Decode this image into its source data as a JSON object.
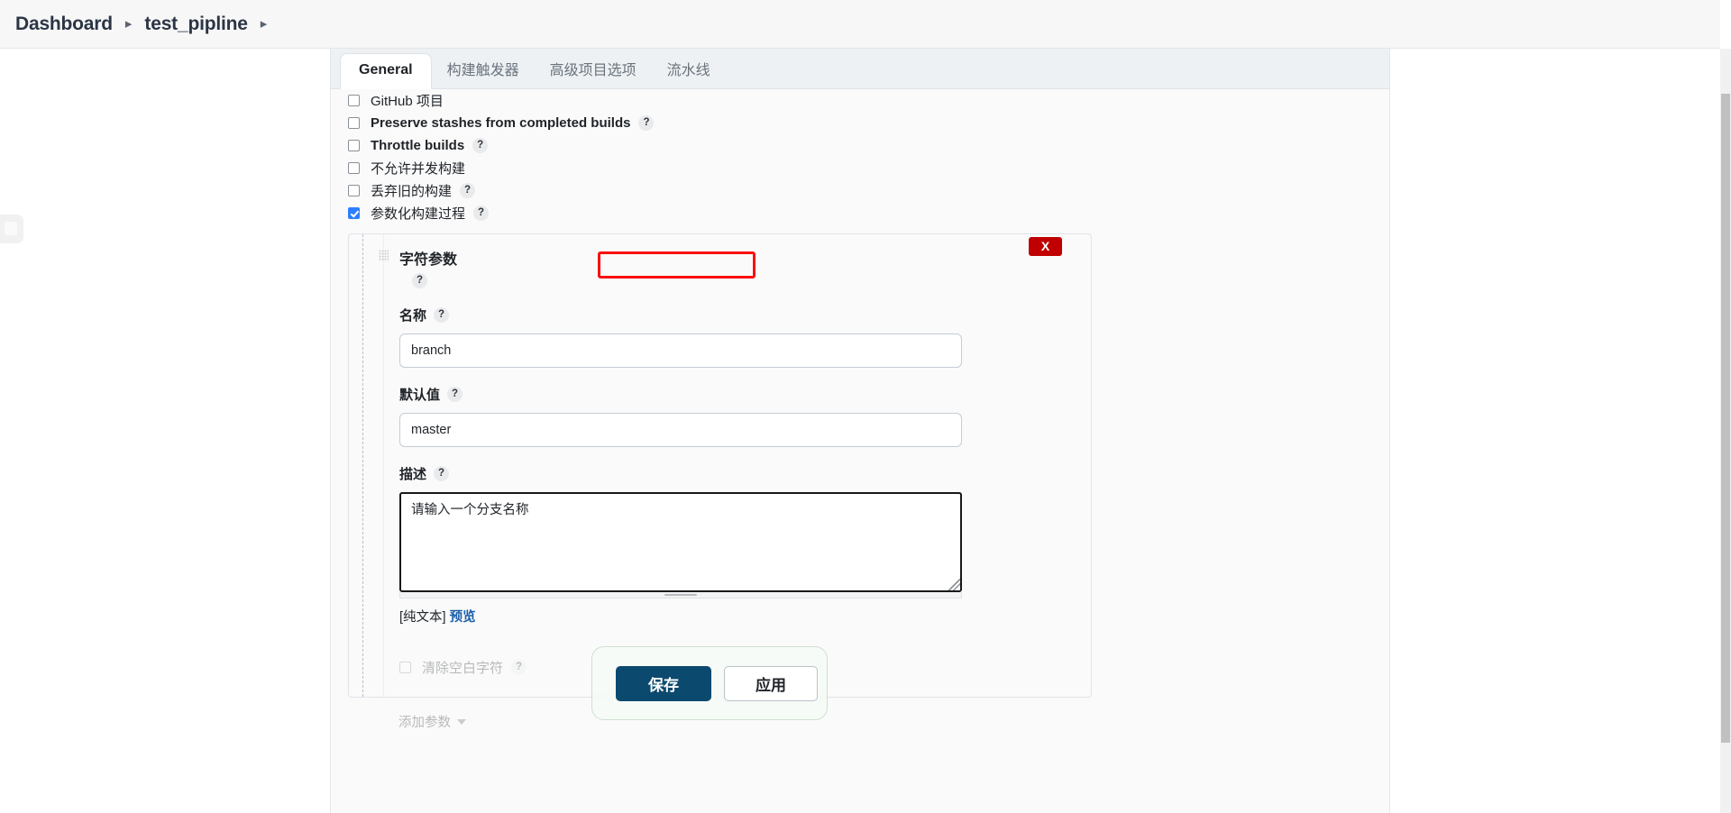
{
  "breadcrumb": {
    "items": [
      {
        "label": "Dashboard"
      },
      {
        "label": "test_pipline"
      }
    ],
    "separator": "▸"
  },
  "tabs": [
    {
      "label": "General",
      "active": true
    },
    {
      "label": "构建触发器",
      "active": false
    },
    {
      "label": "高级项目选项",
      "active": false
    },
    {
      "label": "流水线",
      "active": false
    }
  ],
  "checkboxes": [
    {
      "label": "GitHub 项目",
      "checked": false,
      "help": false,
      "cn": true
    },
    {
      "label": "Preserve stashes from completed builds",
      "checked": false,
      "help": true,
      "cn": false
    },
    {
      "label": "Throttle builds",
      "checked": false,
      "help": true,
      "cn": false
    },
    {
      "label": "不允许并发构建",
      "checked": false,
      "help": false,
      "cn": true
    },
    {
      "label": "丢弃旧的构建",
      "checked": false,
      "help": true,
      "cn": true
    },
    {
      "label": "参数化构建过程",
      "checked": true,
      "help": true,
      "cn": true,
      "highlighted": true
    }
  ],
  "parameter": {
    "title": "字符参数",
    "delete_label": "X",
    "help_glyph": "?",
    "name": {
      "label": "名称",
      "value": "branch"
    },
    "default_value": {
      "label": "默认值",
      "value": "master"
    },
    "description": {
      "label": "描述",
      "value": "请输入一个分支名称",
      "markup_note": "[纯文本]",
      "preview_link": "预览"
    },
    "trim_whitespace": {
      "label": "清除空白字符",
      "checked": false
    },
    "add_parameter": "添加参数"
  },
  "savebar": {
    "save_label": "保存",
    "apply_label": "应用"
  },
  "colors": {
    "accent_blue": "#2b7fff",
    "save_button": "#0b4a6e",
    "delete_red": "#c00000",
    "highlight_red": "#fb1010",
    "link_blue": "#1a5fa8"
  }
}
